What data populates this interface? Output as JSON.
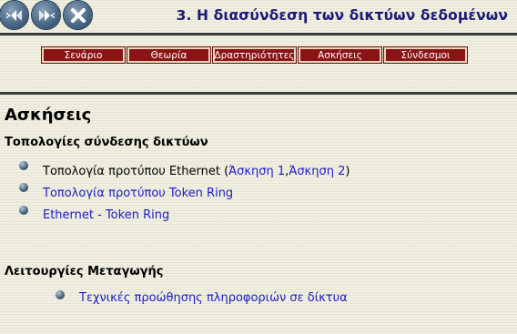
{
  "header": {
    "title": "3. Η διασύνδεση των δικτύων δεδομένων",
    "nav_buttons": [
      "back-icon",
      "forward-icon",
      "close-icon"
    ]
  },
  "menu": [
    {
      "label": "Σενάριο"
    },
    {
      "label": "Θεωρία"
    },
    {
      "label": "Δραστηριότητες"
    },
    {
      "label": "Ασκήσεις"
    },
    {
      "label": "Σύνδεσμοι"
    }
  ],
  "content": {
    "heading": "Ασκήσεις",
    "section1": {
      "title": "Τοπολογίες σύνδεσης δικτύων",
      "item1": {
        "text": "Τοπολογία προτύπου Ethernet (",
        "link1": "Άσκηση 1",
        "sep": ", ",
        "link2": "Άσκηση 2",
        "close": ")"
      },
      "item2": "Τοπολογία προτύπου Token Ring",
      "item3": "Ethernet - Token Ring"
    },
    "section2": {
      "title": "Λειτουργίες Μεταγωγής",
      "item1": "Τεχνικές προώθησης πληροφοριών σε δίκτυα"
    }
  },
  "colors": {
    "background": "#f1efe2",
    "title": "#1a1a7a",
    "menu_bg": "#8a1414",
    "link": "#1c1cc6",
    "rule": "#3b3b3b"
  }
}
